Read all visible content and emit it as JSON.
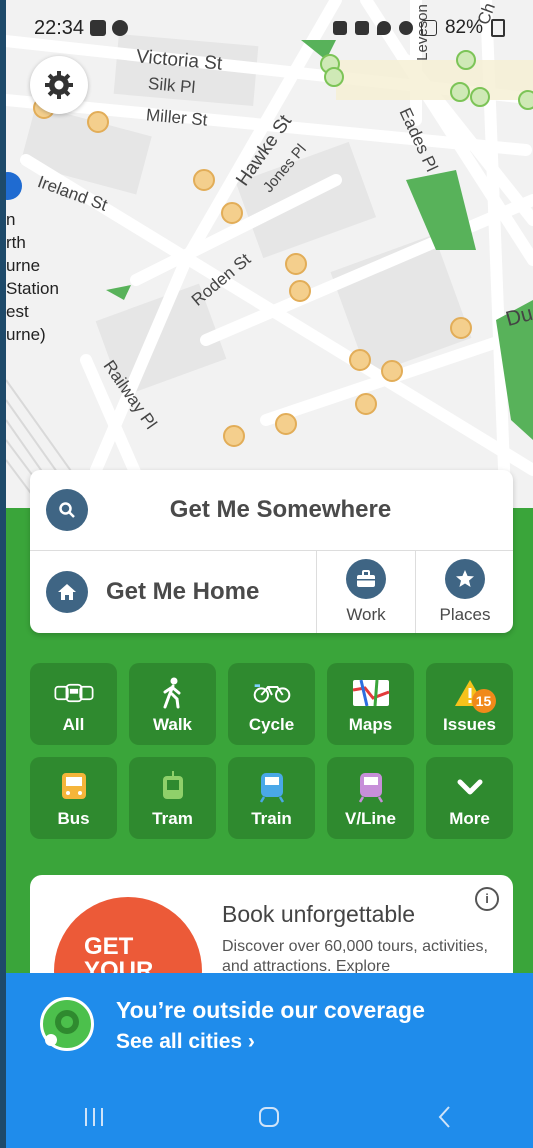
{
  "status_bar": {
    "time": "22:34",
    "battery": "82%"
  },
  "map": {
    "labels": [
      "Victoria St",
      "Silk Pl",
      "Miller St",
      "Hawke St",
      "Jones Pl",
      "Eades Pl",
      "Ireland St",
      "Roden St",
      "Railway Pl",
      "Leveson",
      "Du",
      "Ch"
    ],
    "left_edge_labels": [
      "n",
      "rth",
      "urne",
      "Station",
      "est",
      "urne)"
    ]
  },
  "search_card": {
    "get_me_somewhere": "Get Me Somewhere",
    "get_me_home": "Get Me Home",
    "work": "Work",
    "places": "Places"
  },
  "modes": [
    {
      "label": "All",
      "icon": "all-transport-icon"
    },
    {
      "label": "Walk",
      "icon": "walk-icon"
    },
    {
      "label": "Cycle",
      "icon": "bicycle-icon"
    },
    {
      "label": "Maps",
      "icon": "map-icon"
    },
    {
      "label": "Issues",
      "icon": "warning-icon",
      "badge": "15"
    },
    {
      "label": "Bus",
      "icon": "bus-icon"
    },
    {
      "label": "Tram",
      "icon": "tram-icon"
    },
    {
      "label": "Train",
      "icon": "train-icon"
    },
    {
      "label": "V/Line",
      "icon": "vline-icon"
    },
    {
      "label": "More",
      "icon": "chevron-down-icon"
    }
  ],
  "ad": {
    "logo_text": "GET YOUR",
    "title": "Book unforgettable",
    "description": "Discover over 60,000 tours, activities, and attractions. Explore"
  },
  "coverage_banner": {
    "title": "You’re outside our coverage",
    "link": "See all cities ›"
  },
  "colors": {
    "green": "#3aa53a",
    "tile": "#2f8a2f",
    "blue": "#1f8ceb",
    "circle": "#3f6584"
  }
}
